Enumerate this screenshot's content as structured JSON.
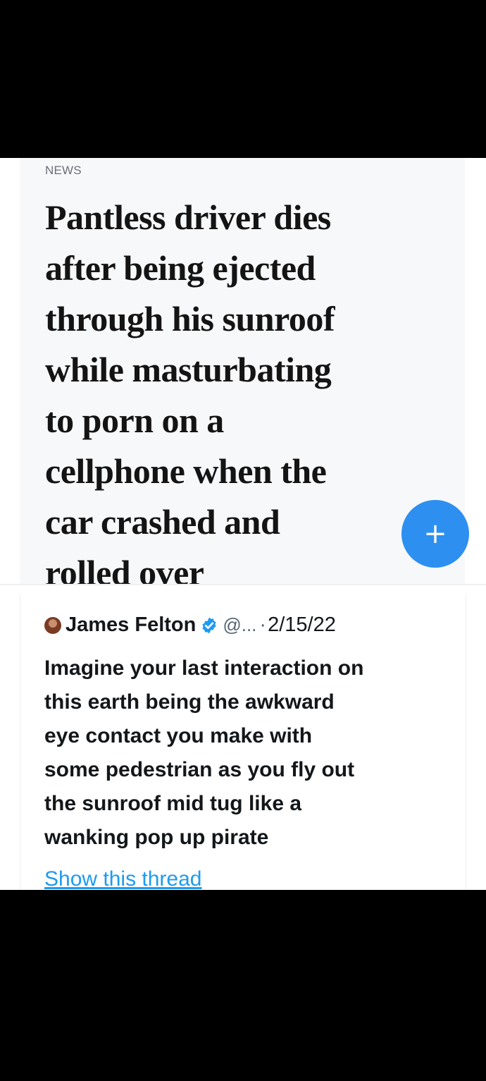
{
  "news": {
    "section_label": "NEWS",
    "headline_lines": [
      "Pantless driver dies",
      "after being ejected",
      "through his sunroof",
      "while masturbating",
      "to porn on a",
      "cellphone when the",
      "car crashed and",
      "rolled over"
    ],
    "fab_icon": "plus-icon",
    "fab_label": "+",
    "fab_color": "#2d8ff0"
  },
  "tweet": {
    "author_name": "James Felton",
    "verified_icon": "verified-badge-icon",
    "handle": "@...",
    "separator": "·",
    "date": "2/15/22",
    "text_lines": [
      "Imagine your last interaction on",
      "this earth being the awkward",
      "eye contact you make with",
      "some pedestrian as you fly out",
      "the sunroof mid tug like a",
      "wanking pop up pirate"
    ],
    "show_thread_label": "Show this thread",
    "link_color": "#1d9bf0"
  }
}
